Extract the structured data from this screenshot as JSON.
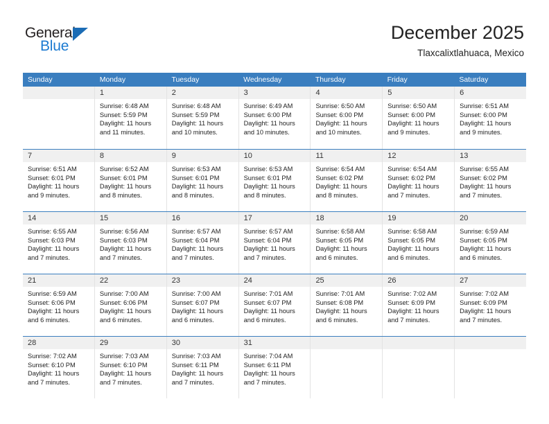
{
  "logo": {
    "primary_text": "General",
    "secondary_text": "Blue",
    "triangle_icon": "triangle-icon",
    "primary_color": "#231f20",
    "secondary_color": "#1b7ad1"
  },
  "header": {
    "title": "December 2025",
    "subtitle": "Tlaxcalixtlahuaca, Mexico"
  },
  "theme": {
    "header_bar_color": "#3a7ebf",
    "day_number_band_color": "#f0f0f0",
    "cell_border_color": "#e3e3e3",
    "text_color": "#222222"
  },
  "weekdays": [
    "Sunday",
    "Monday",
    "Tuesday",
    "Wednesday",
    "Thursday",
    "Friday",
    "Saturday"
  ],
  "weeks": [
    [
      {
        "day": "",
        "sunrise": "",
        "sunset": "",
        "daylight_line1": "",
        "daylight_line2": ""
      },
      {
        "day": "1",
        "sunrise": "Sunrise: 6:48 AM",
        "sunset": "Sunset: 5:59 PM",
        "daylight_line1": "Daylight: 11 hours",
        "daylight_line2": "and 11 minutes."
      },
      {
        "day": "2",
        "sunrise": "Sunrise: 6:48 AM",
        "sunset": "Sunset: 5:59 PM",
        "daylight_line1": "Daylight: 11 hours",
        "daylight_line2": "and 10 minutes."
      },
      {
        "day": "3",
        "sunrise": "Sunrise: 6:49 AM",
        "sunset": "Sunset: 6:00 PM",
        "daylight_line1": "Daylight: 11 hours",
        "daylight_line2": "and 10 minutes."
      },
      {
        "day": "4",
        "sunrise": "Sunrise: 6:50 AM",
        "sunset": "Sunset: 6:00 PM",
        "daylight_line1": "Daylight: 11 hours",
        "daylight_line2": "and 10 minutes."
      },
      {
        "day": "5",
        "sunrise": "Sunrise: 6:50 AM",
        "sunset": "Sunset: 6:00 PM",
        "daylight_line1": "Daylight: 11 hours",
        "daylight_line2": "and 9 minutes."
      },
      {
        "day": "6",
        "sunrise": "Sunrise: 6:51 AM",
        "sunset": "Sunset: 6:00 PM",
        "daylight_line1": "Daylight: 11 hours",
        "daylight_line2": "and 9 minutes."
      }
    ],
    [
      {
        "day": "7",
        "sunrise": "Sunrise: 6:51 AM",
        "sunset": "Sunset: 6:01 PM",
        "daylight_line1": "Daylight: 11 hours",
        "daylight_line2": "and 9 minutes."
      },
      {
        "day": "8",
        "sunrise": "Sunrise: 6:52 AM",
        "sunset": "Sunset: 6:01 PM",
        "daylight_line1": "Daylight: 11 hours",
        "daylight_line2": "and 8 minutes."
      },
      {
        "day": "9",
        "sunrise": "Sunrise: 6:53 AM",
        "sunset": "Sunset: 6:01 PM",
        "daylight_line1": "Daylight: 11 hours",
        "daylight_line2": "and 8 minutes."
      },
      {
        "day": "10",
        "sunrise": "Sunrise: 6:53 AM",
        "sunset": "Sunset: 6:01 PM",
        "daylight_line1": "Daylight: 11 hours",
        "daylight_line2": "and 8 minutes."
      },
      {
        "day": "11",
        "sunrise": "Sunrise: 6:54 AM",
        "sunset": "Sunset: 6:02 PM",
        "daylight_line1": "Daylight: 11 hours",
        "daylight_line2": "and 8 minutes."
      },
      {
        "day": "12",
        "sunrise": "Sunrise: 6:54 AM",
        "sunset": "Sunset: 6:02 PM",
        "daylight_line1": "Daylight: 11 hours",
        "daylight_line2": "and 7 minutes."
      },
      {
        "day": "13",
        "sunrise": "Sunrise: 6:55 AM",
        "sunset": "Sunset: 6:02 PM",
        "daylight_line1": "Daylight: 11 hours",
        "daylight_line2": "and 7 minutes."
      }
    ],
    [
      {
        "day": "14",
        "sunrise": "Sunrise: 6:55 AM",
        "sunset": "Sunset: 6:03 PM",
        "daylight_line1": "Daylight: 11 hours",
        "daylight_line2": "and 7 minutes."
      },
      {
        "day": "15",
        "sunrise": "Sunrise: 6:56 AM",
        "sunset": "Sunset: 6:03 PM",
        "daylight_line1": "Daylight: 11 hours",
        "daylight_line2": "and 7 minutes."
      },
      {
        "day": "16",
        "sunrise": "Sunrise: 6:57 AM",
        "sunset": "Sunset: 6:04 PM",
        "daylight_line1": "Daylight: 11 hours",
        "daylight_line2": "and 7 minutes."
      },
      {
        "day": "17",
        "sunrise": "Sunrise: 6:57 AM",
        "sunset": "Sunset: 6:04 PM",
        "daylight_line1": "Daylight: 11 hours",
        "daylight_line2": "and 7 minutes."
      },
      {
        "day": "18",
        "sunrise": "Sunrise: 6:58 AM",
        "sunset": "Sunset: 6:05 PM",
        "daylight_line1": "Daylight: 11 hours",
        "daylight_line2": "and 6 minutes."
      },
      {
        "day": "19",
        "sunrise": "Sunrise: 6:58 AM",
        "sunset": "Sunset: 6:05 PM",
        "daylight_line1": "Daylight: 11 hours",
        "daylight_line2": "and 6 minutes."
      },
      {
        "day": "20",
        "sunrise": "Sunrise: 6:59 AM",
        "sunset": "Sunset: 6:05 PM",
        "daylight_line1": "Daylight: 11 hours",
        "daylight_line2": "and 6 minutes."
      }
    ],
    [
      {
        "day": "21",
        "sunrise": "Sunrise: 6:59 AM",
        "sunset": "Sunset: 6:06 PM",
        "daylight_line1": "Daylight: 11 hours",
        "daylight_line2": "and 6 minutes."
      },
      {
        "day": "22",
        "sunrise": "Sunrise: 7:00 AM",
        "sunset": "Sunset: 6:06 PM",
        "daylight_line1": "Daylight: 11 hours",
        "daylight_line2": "and 6 minutes."
      },
      {
        "day": "23",
        "sunrise": "Sunrise: 7:00 AM",
        "sunset": "Sunset: 6:07 PM",
        "daylight_line1": "Daylight: 11 hours",
        "daylight_line2": "and 6 minutes."
      },
      {
        "day": "24",
        "sunrise": "Sunrise: 7:01 AM",
        "sunset": "Sunset: 6:07 PM",
        "daylight_line1": "Daylight: 11 hours",
        "daylight_line2": "and 6 minutes."
      },
      {
        "day": "25",
        "sunrise": "Sunrise: 7:01 AM",
        "sunset": "Sunset: 6:08 PM",
        "daylight_line1": "Daylight: 11 hours",
        "daylight_line2": "and 6 minutes."
      },
      {
        "day": "26",
        "sunrise": "Sunrise: 7:02 AM",
        "sunset": "Sunset: 6:09 PM",
        "daylight_line1": "Daylight: 11 hours",
        "daylight_line2": "and 7 minutes."
      },
      {
        "day": "27",
        "sunrise": "Sunrise: 7:02 AM",
        "sunset": "Sunset: 6:09 PM",
        "daylight_line1": "Daylight: 11 hours",
        "daylight_line2": "and 7 minutes."
      }
    ],
    [
      {
        "day": "28",
        "sunrise": "Sunrise: 7:02 AM",
        "sunset": "Sunset: 6:10 PM",
        "daylight_line1": "Daylight: 11 hours",
        "daylight_line2": "and 7 minutes."
      },
      {
        "day": "29",
        "sunrise": "Sunrise: 7:03 AM",
        "sunset": "Sunset: 6:10 PM",
        "daylight_line1": "Daylight: 11 hours",
        "daylight_line2": "and 7 minutes."
      },
      {
        "day": "30",
        "sunrise": "Sunrise: 7:03 AM",
        "sunset": "Sunset: 6:11 PM",
        "daylight_line1": "Daylight: 11 hours",
        "daylight_line2": "and 7 minutes."
      },
      {
        "day": "31",
        "sunrise": "Sunrise: 7:04 AM",
        "sunset": "Sunset: 6:11 PM",
        "daylight_line1": "Daylight: 11 hours",
        "daylight_line2": "and 7 minutes."
      },
      {
        "day": "",
        "sunrise": "",
        "sunset": "",
        "daylight_line1": "",
        "daylight_line2": ""
      },
      {
        "day": "",
        "sunrise": "",
        "sunset": "",
        "daylight_line1": "",
        "daylight_line2": ""
      },
      {
        "day": "",
        "sunrise": "",
        "sunset": "",
        "daylight_line1": "",
        "daylight_line2": ""
      }
    ]
  ]
}
